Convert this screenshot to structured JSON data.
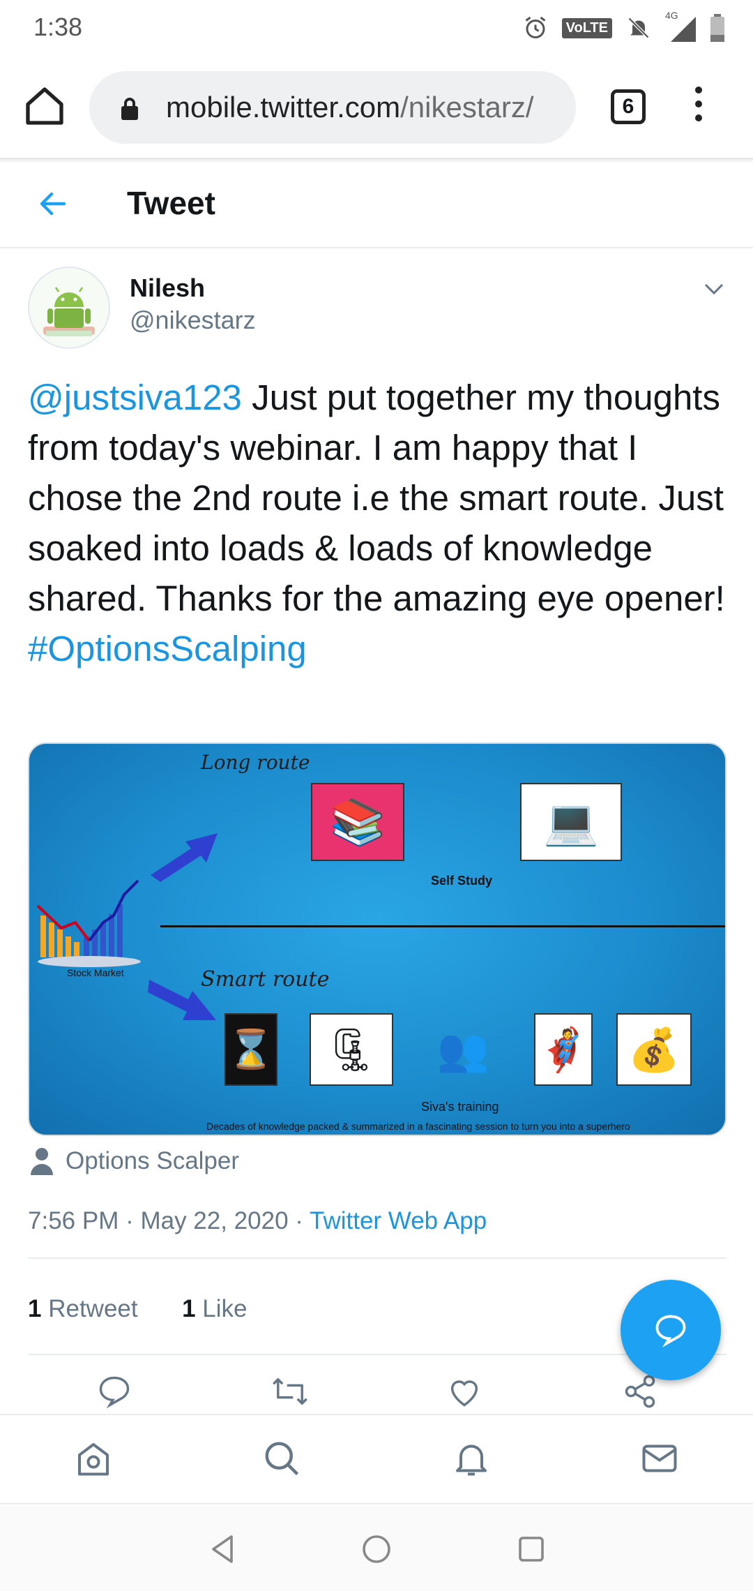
{
  "status_bar": {
    "time": "1:38",
    "volte_badge": "VoLTE",
    "network": "4G",
    "icons": [
      "alarm-icon",
      "volte-icon",
      "notifications-off-icon",
      "signal-icon",
      "battery-icon"
    ]
  },
  "browser": {
    "url_domain": "mobile.twitter.com",
    "url_path": "/nikestarz/",
    "tab_count": "6"
  },
  "header": {
    "title": "Tweet"
  },
  "tweet": {
    "author_name": "Nilesh",
    "author_handle": "@nikestarz",
    "mention": "@justsiva123",
    "body": " Just put together my thoughts from today's webinar. I am happy that I chose the 2nd route i.e the smart route. Just soaked into loads & loads of knowledge shared. Thanks for the amazing eye opener!",
    "hashtag": "#OptionsScalping",
    "source_account": "Options Scalper",
    "timestamp": "7:56 PM · May 22, 2020 · ",
    "client": "Twitter Web App",
    "retweet_count": "1",
    "retweet_label": "Retweet",
    "like_count": "1",
    "like_label": "Like"
  },
  "media": {
    "long_route": "Long route",
    "self_study": "Self Study",
    "stock_market": "Stock Market",
    "smart_route": "Smart route",
    "training": "Siva's training",
    "caption": "Decades of knowledge packed & summarized in a fascinating session to turn you into a superhero"
  },
  "colors": {
    "accent": "#1da1f2",
    "link": "#1b95e0",
    "muted": "#657786",
    "media_bg": "#1c8ccd"
  }
}
